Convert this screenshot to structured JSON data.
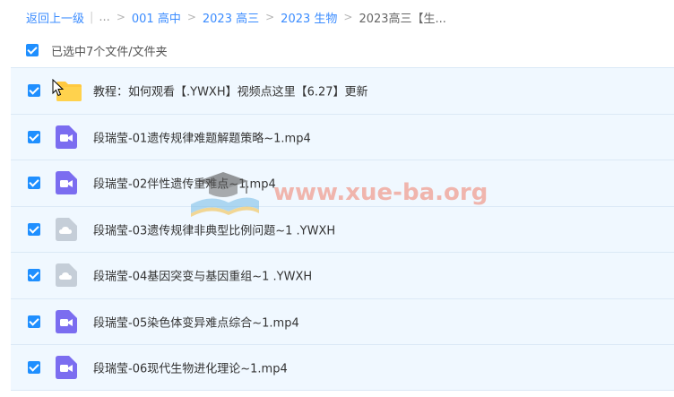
{
  "breadcrumb": {
    "back_label": "返回上一级",
    "ellipsis": "...",
    "separator": ">",
    "items": [
      "001 高中",
      "2023 高三",
      "2023 生物"
    ],
    "current": "2023高三【生..."
  },
  "selection": {
    "text": "已选中7个文件/文件夹",
    "checked": true
  },
  "files": [
    {
      "name": "教程：如何观看【.YWXH】视频点这里【6.27】更新",
      "icon": "folder-icon",
      "checked": true
    },
    {
      "name": "段瑞莹-01遗传规律难题解题策略~1.mp4",
      "icon": "video-file-icon",
      "checked": true
    },
    {
      "name": "段瑞莹-02伴性遗传重难点~1.mp4",
      "icon": "video-file-icon",
      "checked": true
    },
    {
      "name": "段瑞莹-03遗传规律非典型比例问题~1 .YWXH",
      "icon": "cloud-file-icon",
      "checked": true
    },
    {
      "name": "段瑞莹-04基因突变与基因重组~1 .YWXH",
      "icon": "cloud-file-icon",
      "checked": true
    },
    {
      "name": "段瑞莹-05染色体变异难点综合~1.mp4",
      "icon": "video-file-icon",
      "checked": true
    },
    {
      "name": "段瑞莹-06现代生物进化理论~1.mp4",
      "icon": "video-file-icon",
      "checked": true
    }
  ],
  "watermark": {
    "text": "www.xue-ba.org"
  },
  "colors": {
    "link": "#3b8cff",
    "checkbox": "#1f8fff",
    "row_background": "#f0f8ff",
    "folder": "#ffc940",
    "video_icon": "#7b6df0",
    "cloud_file_icon": "#c5ced8"
  }
}
